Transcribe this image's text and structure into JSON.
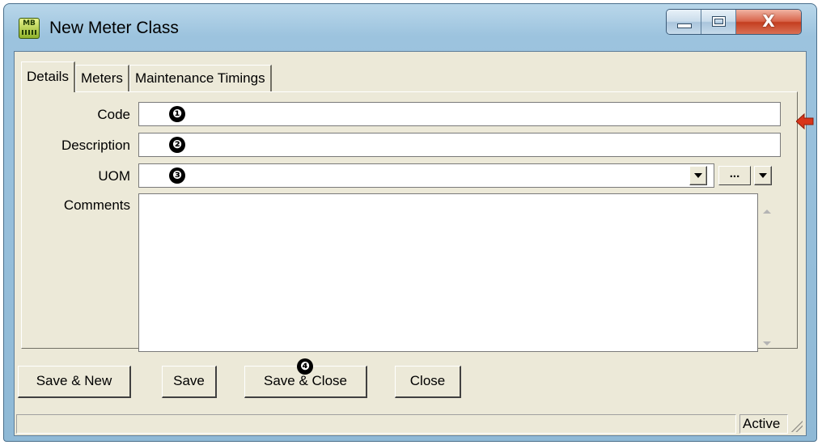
{
  "window": {
    "title": "New Meter Class",
    "app_icon_text": "MB",
    "controls": {
      "minimize": "",
      "maximize": "",
      "close": "X"
    }
  },
  "tabs": [
    {
      "label": "Details",
      "active": true
    },
    {
      "label": "Meters",
      "active": false
    },
    {
      "label": "Maintenance Timings",
      "active": false
    }
  ],
  "form": {
    "code": {
      "label": "Code",
      "value": "",
      "required": true,
      "callout": "❶"
    },
    "description": {
      "label": "Description",
      "value": "",
      "callout": "❷"
    },
    "uom": {
      "label": "UOM",
      "value": "",
      "callout": "❸",
      "browse_label": "..."
    },
    "comments": {
      "label": "Comments",
      "value": ""
    }
  },
  "buttons": {
    "save_new": "Save & New",
    "save": "Save",
    "save_close": "Save & Close",
    "close": "Close",
    "callout": "❹"
  },
  "status": {
    "left": "",
    "right": "Active"
  },
  "colors": {
    "required_arrow": "#d8351a",
    "titlebar": "#9cc3de",
    "client": "#ece9d8"
  }
}
